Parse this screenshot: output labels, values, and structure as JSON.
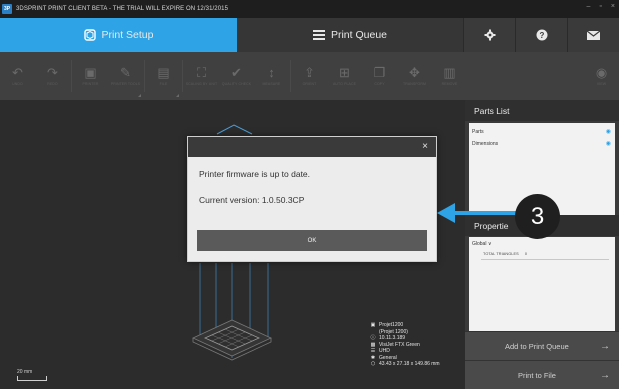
{
  "titlebar": {
    "logo_text": "3P",
    "title": "3DSPRINT PRINT CLIENT BETA - THE TRIAL WILL EXPIRE ON 12/31/2015",
    "minimize": "–",
    "restore": "▫",
    "close": "×"
  },
  "tabs": {
    "print_setup": "Print Setup",
    "print_queue": "Print Queue",
    "settings_icon": "gear-icon",
    "help_icon": "question-icon",
    "mail_icon": "mail-icon"
  },
  "toolbar": {
    "undo": "UNDO",
    "redo": "REDO",
    "printer": "PRINTER",
    "printer_tools": "PRINTER TOOLS",
    "file": "FILE",
    "scaling_unit": "SCALING BY UNIT",
    "quality_check": "QUALITY CHECK",
    "measure": "MEASURE",
    "orient": "ORIENT",
    "auto_place": "AUTO PLACE",
    "copy": "COPY",
    "transform": "TRANSFORM",
    "remove": "REMOVE",
    "view": "VIEW"
  },
  "viewport": {
    "scale_label": "20 mm",
    "printer_info": {
      "model": "Projet1200",
      "model_sub": "(Projet 1200)",
      "ip": "10.11.3.189",
      "material": "VisiJet FTX Green",
      "resolution": "UHD",
      "profile": "General",
      "dimensions": "43.43 x 27.18 x 149.86 mm"
    }
  },
  "parts_list": {
    "header": "Parts List",
    "items": [
      "Parts",
      "Dimensions"
    ]
  },
  "properties": {
    "header": "Propertie",
    "global_label": "Global",
    "total_triangles_label": "TOTAL TRIANGLES",
    "total_triangles_value": "0"
  },
  "actions": {
    "add_to_queue": "Add to Print Queue",
    "print_to_file": "Print to File"
  },
  "dialog": {
    "message": "Printer firmware is up to date.",
    "version_text": "Current version:  1.0.50.3CP",
    "ok_label": "OK",
    "close_glyph": "×"
  },
  "callout": {
    "number": "3",
    "color": "#2ea3e6"
  },
  "colors": {
    "accent": "#2ea3e6",
    "panel": "#3a3a3a",
    "viewport": "#2c2c2c"
  }
}
